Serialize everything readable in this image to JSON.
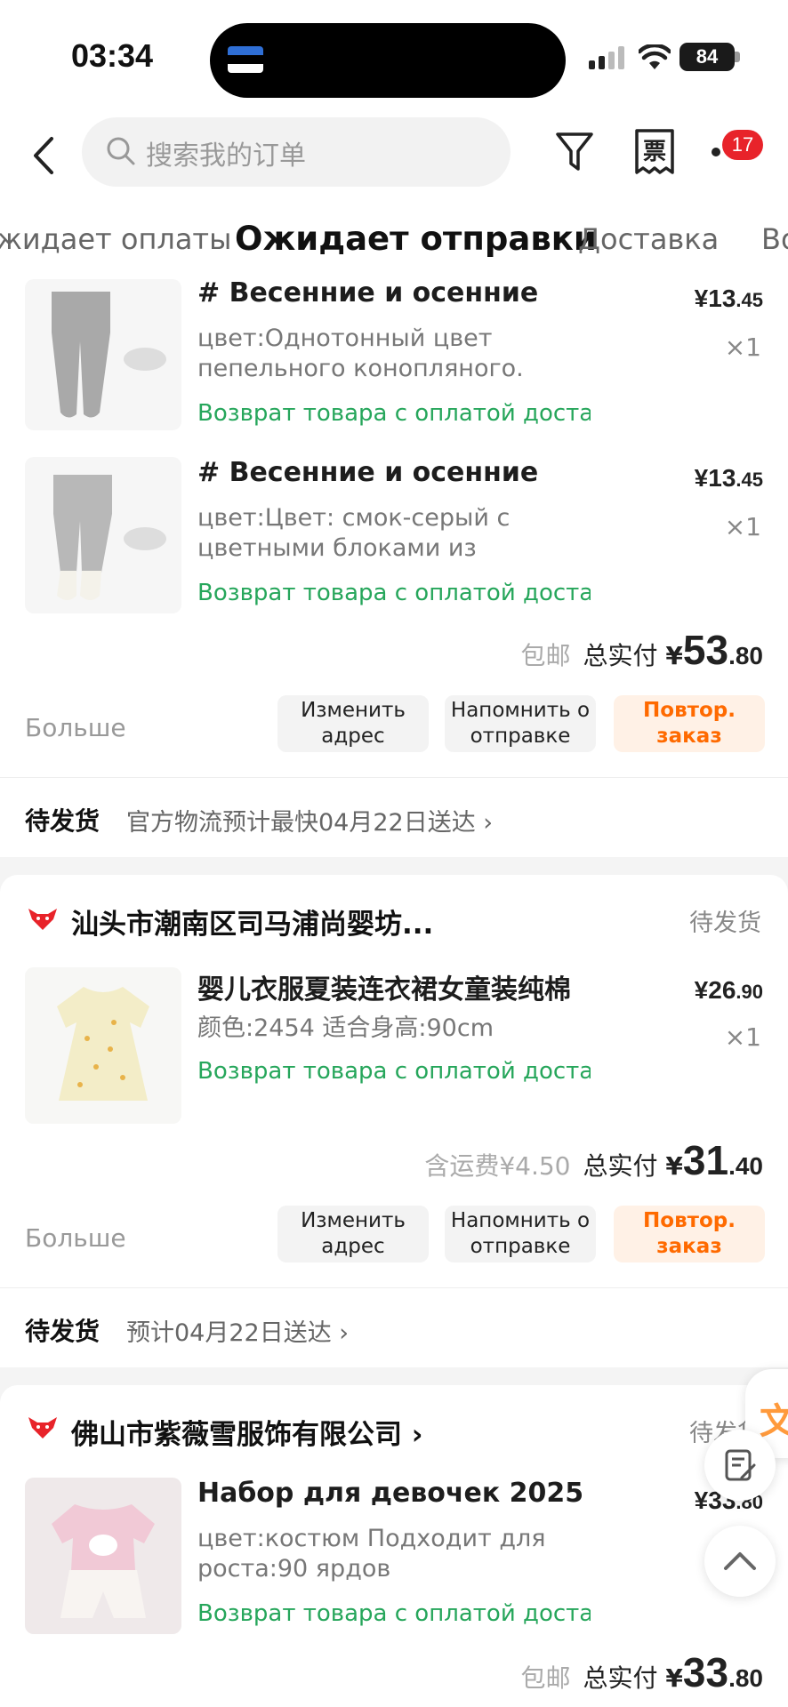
{
  "status_bar": {
    "time": "03:34",
    "battery": "84"
  },
  "header": {
    "search_placeholder": "搜索我的订单",
    "invoice_label": "票",
    "notification_count": "17"
  },
  "tabs": [
    {
      "label": "жидает оплаты",
      "active": false
    },
    {
      "label": "Ожидает отправки",
      "active": true
    },
    {
      "label": "Доставка",
      "active": false
    },
    {
      "label": "Во",
      "active": false
    }
  ],
  "order1": {
    "items": [
      {
        "title": "# Весенние и осенние",
        "spec": "цвет:Однотонный цвет пепельного конопляного.",
        "return_note": "Возврат товара с оплатой достав",
        "price_int": "13",
        "price_dec": ".45",
        "currency": "¥",
        "qty": "×1"
      },
      {
        "title": "# Весенние и осенние",
        "spec": "цвет:Цвет: смок-серый с цветными блоками из",
        "return_note": "Возврат товара с оплатой достав",
        "price_int": "13",
        "price_dec": ".45",
        "currency": "¥",
        "qty": "×1"
      }
    ],
    "shipping_label": "包邮",
    "total_label": "总实付",
    "total_currency": "¥",
    "total_int": "53",
    "total_dec": ".80",
    "more": "Больше",
    "buttons": [
      "Изменить адрес",
      "Напомнить о отправке",
      "Повтор. заказ"
    ],
    "status_label": "待发货",
    "status_text": "官方物流预计最快04月22日送达 ›"
  },
  "order2": {
    "shop_name": "汕头市潮南区司马浦尚婴坊...",
    "shop_status": "待发货",
    "item": {
      "title": "婴儿衣服夏装连衣裙女童装纯棉",
      "spec": "颜色:2454 适合身高:90cm",
      "return_note": "Возврат товара с оплатой достав",
      "price_int": "26",
      "price_dec": ".90",
      "currency": "¥",
      "qty": "×1"
    },
    "shipping_label": "含运费¥4.50",
    "total_label": "总实付",
    "total_currency": "¥",
    "total_int": "31",
    "total_dec": ".40",
    "more": "Больше",
    "buttons": [
      "Изменить адрес",
      "Напомнить о отправке",
      "Повтор. заказ"
    ],
    "status_label": "待发货",
    "status_text": "预计04月22日送达 ›"
  },
  "order3": {
    "shop_name": "佛山市紫薇雪服饰有限公司 ›",
    "shop_status": "待发货",
    "item": {
      "title": "Набор для девочек 2025",
      "spec": "цвет:костюм Подходит для роста:90 ярдов",
      "return_note": "Возврат товара с оплатой достав",
      "price_int": "33",
      "price_dec": ".80",
      "currency": "¥"
    },
    "shipping_label": "包邮",
    "total_label": "总实付",
    "total_currency": "¥",
    "total_int": "33",
    "total_dec": ".80"
  },
  "floating": {
    "translate_label": "文"
  },
  "colors": {
    "accent_orange": "#ff6a00",
    "return_green": "#26a65b",
    "badge_red": "#e8232a"
  }
}
